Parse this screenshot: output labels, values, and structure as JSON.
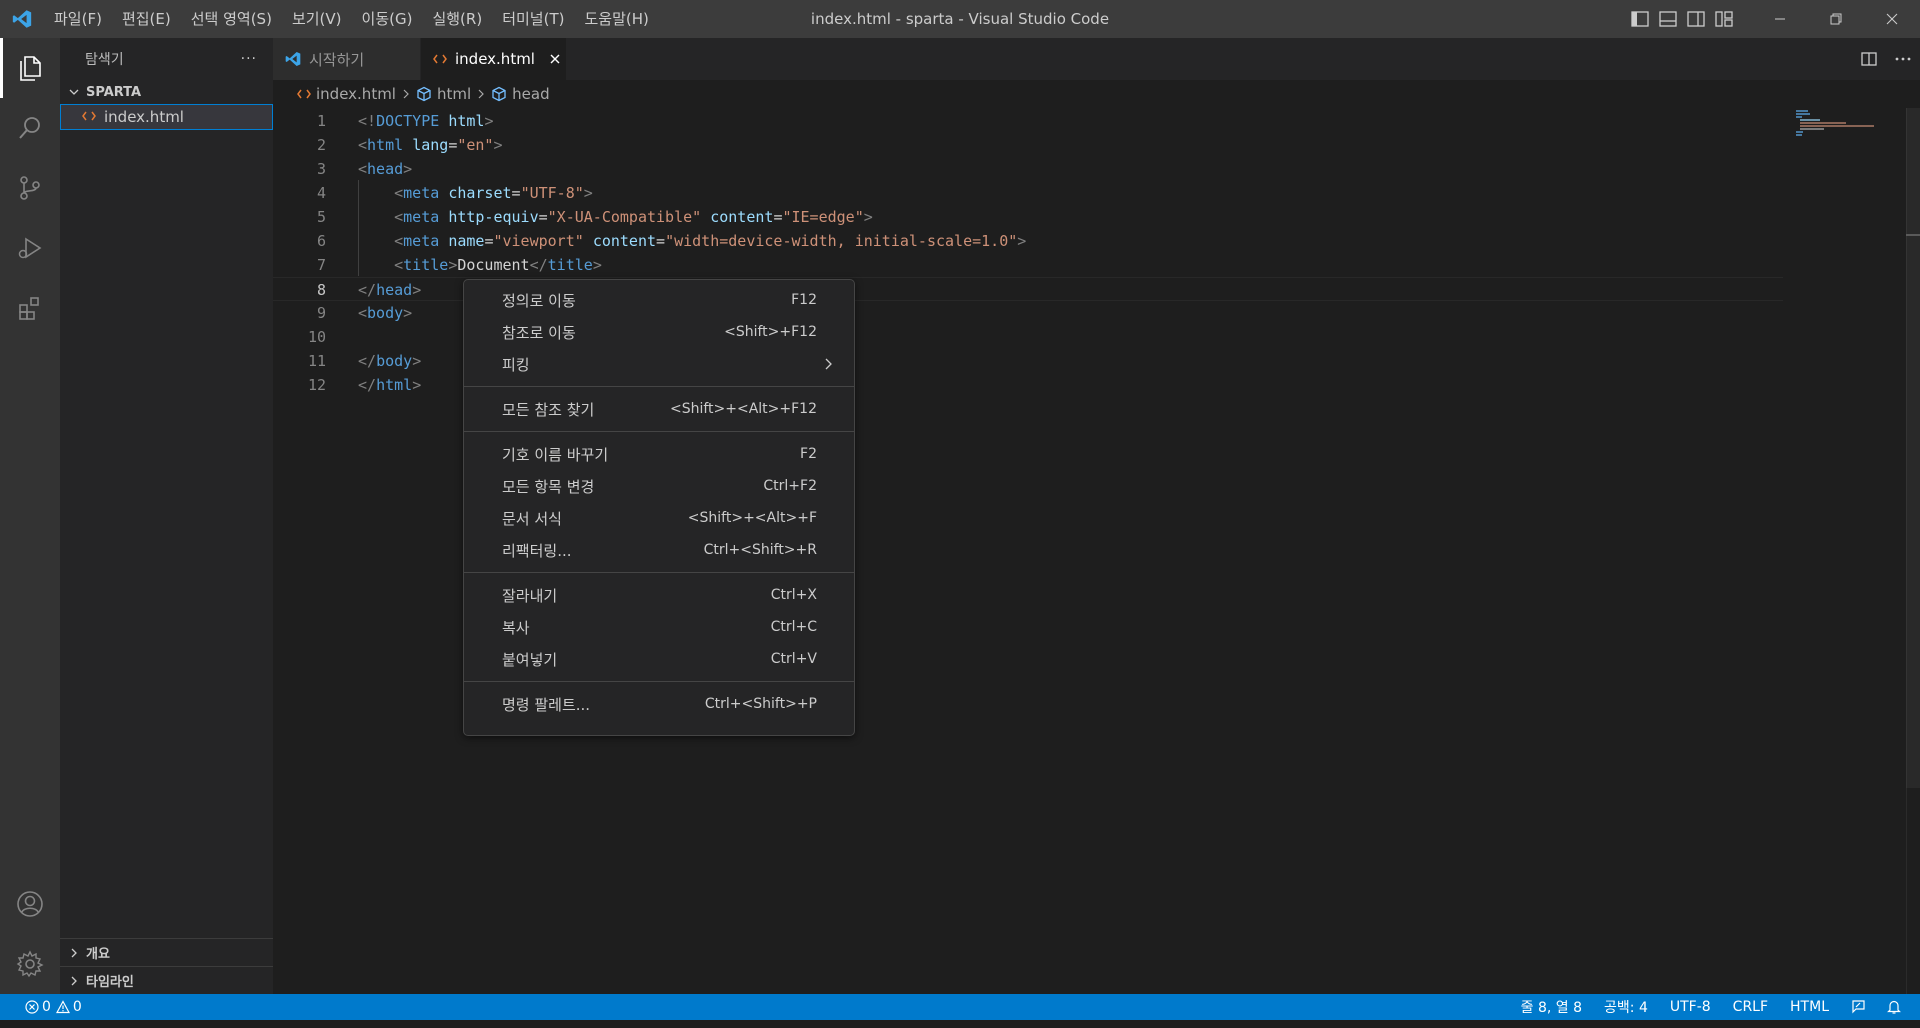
{
  "titlebar": {
    "menus": [
      "파일(F)",
      "편집(E)",
      "선택 영역(S)",
      "보기(V)",
      "이동(G)",
      "실행(R)",
      "터미널(T)",
      "도움말(H)"
    ],
    "window_title": "index.html - sparta - Visual Studio Code"
  },
  "activity_bar": {
    "top": [
      "files-icon",
      "search-icon",
      "source-control-icon",
      "run-debug-icon",
      "extensions-icon"
    ],
    "bottom": [
      "account-icon",
      "settings-gear-icon"
    ]
  },
  "sidebar": {
    "title": "탐색기",
    "more_label": "···",
    "folder": "SPARTA",
    "files": [
      "index.html"
    ],
    "sections": [
      "개요",
      "타임라인"
    ]
  },
  "tabs": [
    {
      "label": "시작하기",
      "active": false
    },
    {
      "label": "index.html",
      "active": true
    }
  ],
  "breadcrumb": {
    "file": "index.html",
    "items": [
      "html",
      "head"
    ]
  },
  "editor": {
    "current_line": 8,
    "lines": [
      {
        "n": "1",
        "tokens": [
          [
            "p",
            "<!"
          ],
          [
            "t",
            "DOCTYPE"
          ],
          [
            "x",
            " "
          ],
          [
            "a",
            "html"
          ],
          [
            "p",
            ">"
          ]
        ]
      },
      {
        "n": "2",
        "tokens": [
          [
            "p",
            "<"
          ],
          [
            "t",
            "html"
          ],
          [
            "x",
            " "
          ],
          [
            "a",
            "lang"
          ],
          [
            "x",
            "="
          ],
          [
            "s",
            "\"en\""
          ],
          [
            "p",
            ">"
          ]
        ]
      },
      {
        "n": "3",
        "tokens": [
          [
            "p",
            "<"
          ],
          [
            "t",
            "head"
          ],
          [
            "p",
            ">"
          ]
        ]
      },
      {
        "n": "4",
        "tokens": [
          [
            "x",
            "    "
          ],
          [
            "p",
            "<"
          ],
          [
            "t",
            "meta"
          ],
          [
            "x",
            " "
          ],
          [
            "a",
            "charset"
          ],
          [
            "x",
            "="
          ],
          [
            "s",
            "\"UTF-8\""
          ],
          [
            "p",
            ">"
          ]
        ]
      },
      {
        "n": "5",
        "tokens": [
          [
            "x",
            "    "
          ],
          [
            "p",
            "<"
          ],
          [
            "t",
            "meta"
          ],
          [
            "x",
            " "
          ],
          [
            "a",
            "http-equiv"
          ],
          [
            "x",
            "="
          ],
          [
            "s",
            "\"X-UA-Compatible\""
          ],
          [
            "x",
            " "
          ],
          [
            "a",
            "content"
          ],
          [
            "x",
            "="
          ],
          [
            "s",
            "\"IE=edge\""
          ],
          [
            "p",
            ">"
          ]
        ]
      },
      {
        "n": "6",
        "tokens": [
          [
            "x",
            "    "
          ],
          [
            "p",
            "<"
          ],
          [
            "t",
            "meta"
          ],
          [
            "x",
            " "
          ],
          [
            "a",
            "name"
          ],
          [
            "x",
            "="
          ],
          [
            "s",
            "\"viewport\""
          ],
          [
            "x",
            " "
          ],
          [
            "a",
            "content"
          ],
          [
            "x",
            "="
          ],
          [
            "s",
            "\"width=device-width, initial-scale=1.0\""
          ],
          [
            "p",
            ">"
          ]
        ]
      },
      {
        "n": "7",
        "tokens": [
          [
            "x",
            "    "
          ],
          [
            "p",
            "<"
          ],
          [
            "t",
            "title"
          ],
          [
            "p",
            ">"
          ],
          [
            "x",
            "Document"
          ],
          [
            "p",
            "</"
          ],
          [
            "t",
            "title"
          ],
          [
            "p",
            ">"
          ]
        ]
      },
      {
        "n": "8",
        "tokens": [
          [
            "p",
            "</"
          ],
          [
            "t",
            "head"
          ],
          [
            "p",
            ">"
          ]
        ]
      },
      {
        "n": "9",
        "tokens": [
          [
            "p",
            "<"
          ],
          [
            "t",
            "body"
          ],
          [
            "p",
            ">"
          ]
        ]
      },
      {
        "n": "10",
        "tokens": []
      },
      {
        "n": "11",
        "tokens": [
          [
            "p",
            "</"
          ],
          [
            "t",
            "body"
          ],
          [
            "p",
            ">"
          ]
        ]
      },
      {
        "n": "12",
        "tokens": [
          [
            "p",
            "</"
          ],
          [
            "t",
            "html"
          ],
          [
            "p",
            ">"
          ]
        ]
      }
    ]
  },
  "context_menu": {
    "groups": [
      [
        {
          "label": "정의로 이동",
          "key": "F12"
        },
        {
          "label": "참조로 이동",
          "key": "<Shift>+F12"
        },
        {
          "label": "피킹",
          "key": "",
          "submenu": true
        }
      ],
      [
        {
          "label": "모든 참조 찾기",
          "key": "<Shift>+<Alt>+F12"
        }
      ],
      [
        {
          "label": "기호 이름 바꾸기",
          "key": "F2"
        },
        {
          "label": "모든 항목 변경",
          "key": "Ctrl+F2"
        },
        {
          "label": "문서 서식",
          "key": "<Shift>+<Alt>+F"
        },
        {
          "label": "리팩터링...",
          "key": "Ctrl+<Shift>+R"
        }
      ],
      [
        {
          "label": "잘라내기",
          "key": "Ctrl+X"
        },
        {
          "label": "복사",
          "key": "Ctrl+C"
        },
        {
          "label": "붙여넣기",
          "key": "Ctrl+V"
        }
      ],
      [
        {
          "label": "명령 팔레트...",
          "key": "Ctrl+<Shift>+P"
        }
      ]
    ]
  },
  "statusbar": {
    "errors": "0",
    "warnings": "0",
    "position": "줄 8, 열 8",
    "spaces": "공백: 4",
    "encoding": "UTF-8",
    "eol": "CRLF",
    "language": "HTML"
  },
  "colors": {
    "accent": "#007acc",
    "html_icon": "#e37933",
    "vscode_logo": "#3ca4e8"
  }
}
